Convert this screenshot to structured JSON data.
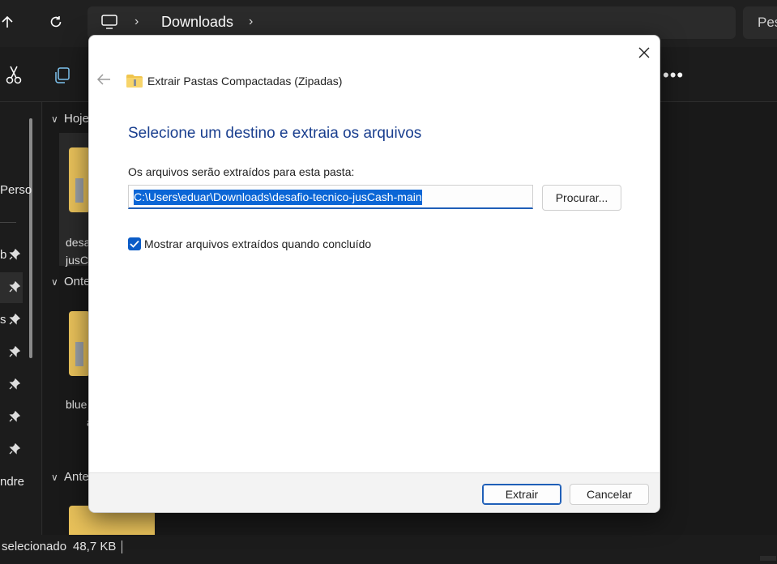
{
  "explorer": {
    "address": {
      "location": "Downloads",
      "search_placeholder": "Pes"
    },
    "sidebar": {
      "items": [
        {
          "label": "Perso"
        },
        {
          "label": "b"
        },
        {
          "label": "s"
        },
        {
          "label": "ndre"
        }
      ]
    },
    "groups": [
      {
        "label": "Hoje"
      },
      {
        "label": "Onte"
      },
      {
        "label": "Ante"
      }
    ],
    "files": [
      {
        "line1": "desa",
        "line2": "jusC"
      },
      {
        "line1": "blue",
        "line2": "a"
      }
    ],
    "status": {
      "selection": "selecionado",
      "size": "48,7 KB"
    }
  },
  "dialog": {
    "title": "Extrair Pastas Compactadas (Zipadas)",
    "heading": "Selecione um destino e extraia os arquivos",
    "path_label": "Os arquivos serão extraídos para esta pasta:",
    "path_value": "C:\\Users\\eduar\\Downloads\\desafio-tecnico-jusCash-main",
    "browse_label": "Procurar...",
    "show_files_label": "Mostrar arquivos extraídos quando concluído",
    "show_files_checked": true,
    "extract_label": "Extrair",
    "cancel_label": "Cancelar",
    "accent_color": "#0b5cc7"
  }
}
